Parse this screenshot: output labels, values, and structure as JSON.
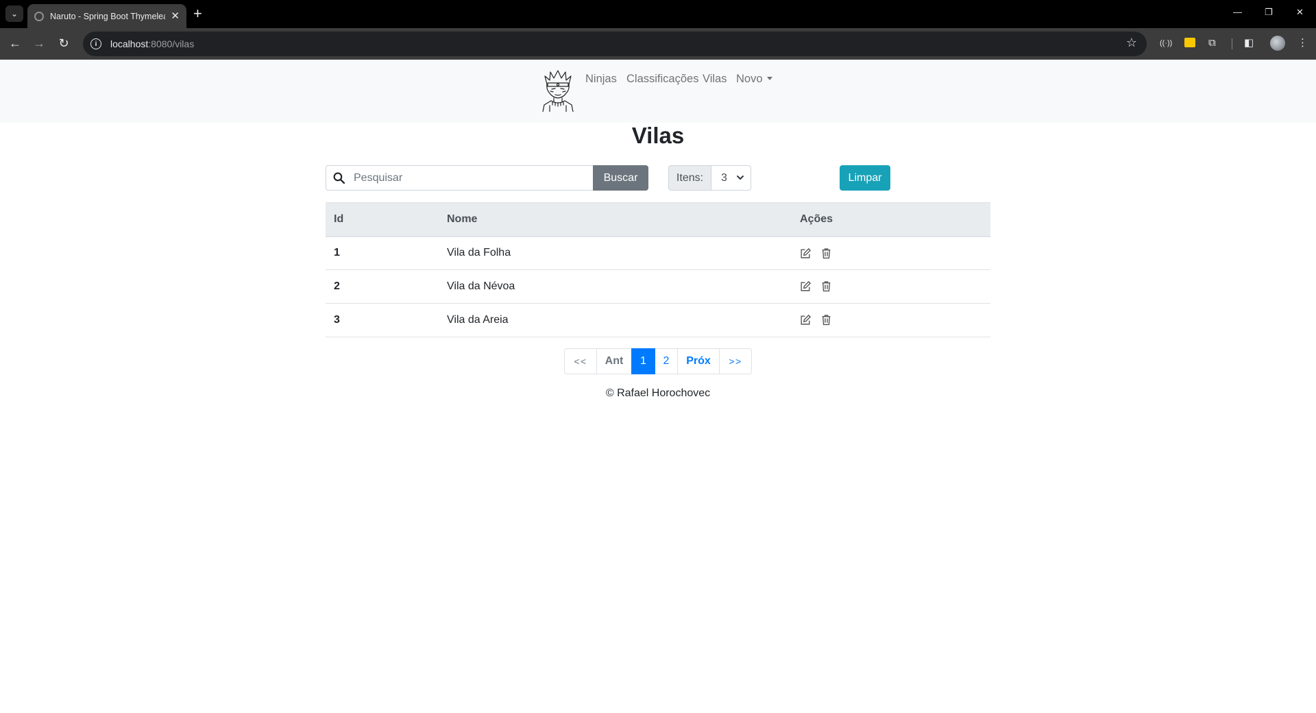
{
  "browser": {
    "tab_title": "Naruto - Spring Boot Thymeleaf",
    "url_host": "localhost",
    "url_path": ":8080/vilas",
    "new_tab_symbol": "+",
    "close_symbol": "✕"
  },
  "navbar": {
    "links": [
      "Ninjas",
      "Classificações",
      "Vilas"
    ],
    "dropdown_label": "Novo"
  },
  "page": {
    "title": "Vilas"
  },
  "search": {
    "placeholder": "Pesquisar",
    "button_label": "Buscar"
  },
  "itens": {
    "label": "Itens:",
    "selected": "3"
  },
  "clear_button": "Limpar",
  "table": {
    "headers": [
      "Id",
      "Nome",
      "Ações"
    ],
    "rows": [
      {
        "id": "1",
        "nome": "Vila da Folha"
      },
      {
        "id": "2",
        "nome": "Vila da Névoa"
      },
      {
        "id": "3",
        "nome": "Vila da Areia"
      }
    ]
  },
  "pagination": {
    "first": "<<",
    "prev": "Ant",
    "pages": [
      "1",
      "2"
    ],
    "active_page": "1",
    "next": "Próx",
    "last": ">>"
  },
  "footer": "© Rafael Horochovec",
  "colors": {
    "primary": "#007bff",
    "info": "#17a2b8",
    "secondary": "#6c757d",
    "navbar_bg": "#f8f9fa"
  }
}
